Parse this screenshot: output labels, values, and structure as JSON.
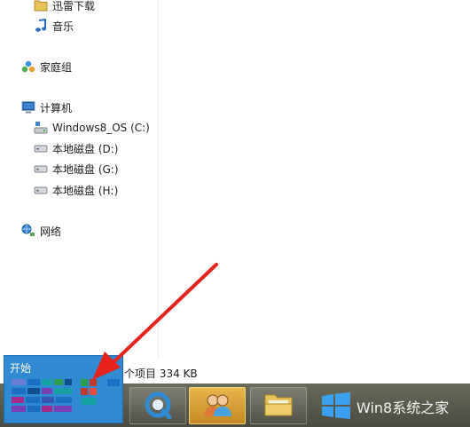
{
  "nav": {
    "items": [
      {
        "label": "迅雷下载",
        "icon": "folder-icon"
      },
      {
        "label": "音乐",
        "icon": "music-icon"
      },
      {
        "label": "家庭组",
        "icon": "homegroup-icon"
      },
      {
        "label": "计算机",
        "icon": "computer-icon"
      },
      {
        "label": "Windows8_OS (C:)",
        "icon": "system-drive-icon"
      },
      {
        "label": "本地磁盘 (D:)",
        "icon": "drive-icon"
      },
      {
        "label": "本地磁盘 (G:)",
        "icon": "drive-icon"
      },
      {
        "label": "本地磁盘 (H:)",
        "icon": "drive-icon"
      },
      {
        "label": "网络",
        "icon": "network-icon"
      }
    ]
  },
  "status": {
    "text": "个项目  334 KB"
  },
  "start": {
    "label": "开始"
  },
  "taskbar": {
    "buttons": [
      {
        "icon": "browser-icon"
      },
      {
        "icon": "users-icon"
      },
      {
        "icon": "file-explorer-icon"
      }
    ]
  },
  "watermark": {
    "text": "Win8系统之家"
  },
  "colors": {
    "accent": "#2f8ad3",
    "arrow": "#e8231c",
    "taskbar": "#5a5a4e"
  }
}
